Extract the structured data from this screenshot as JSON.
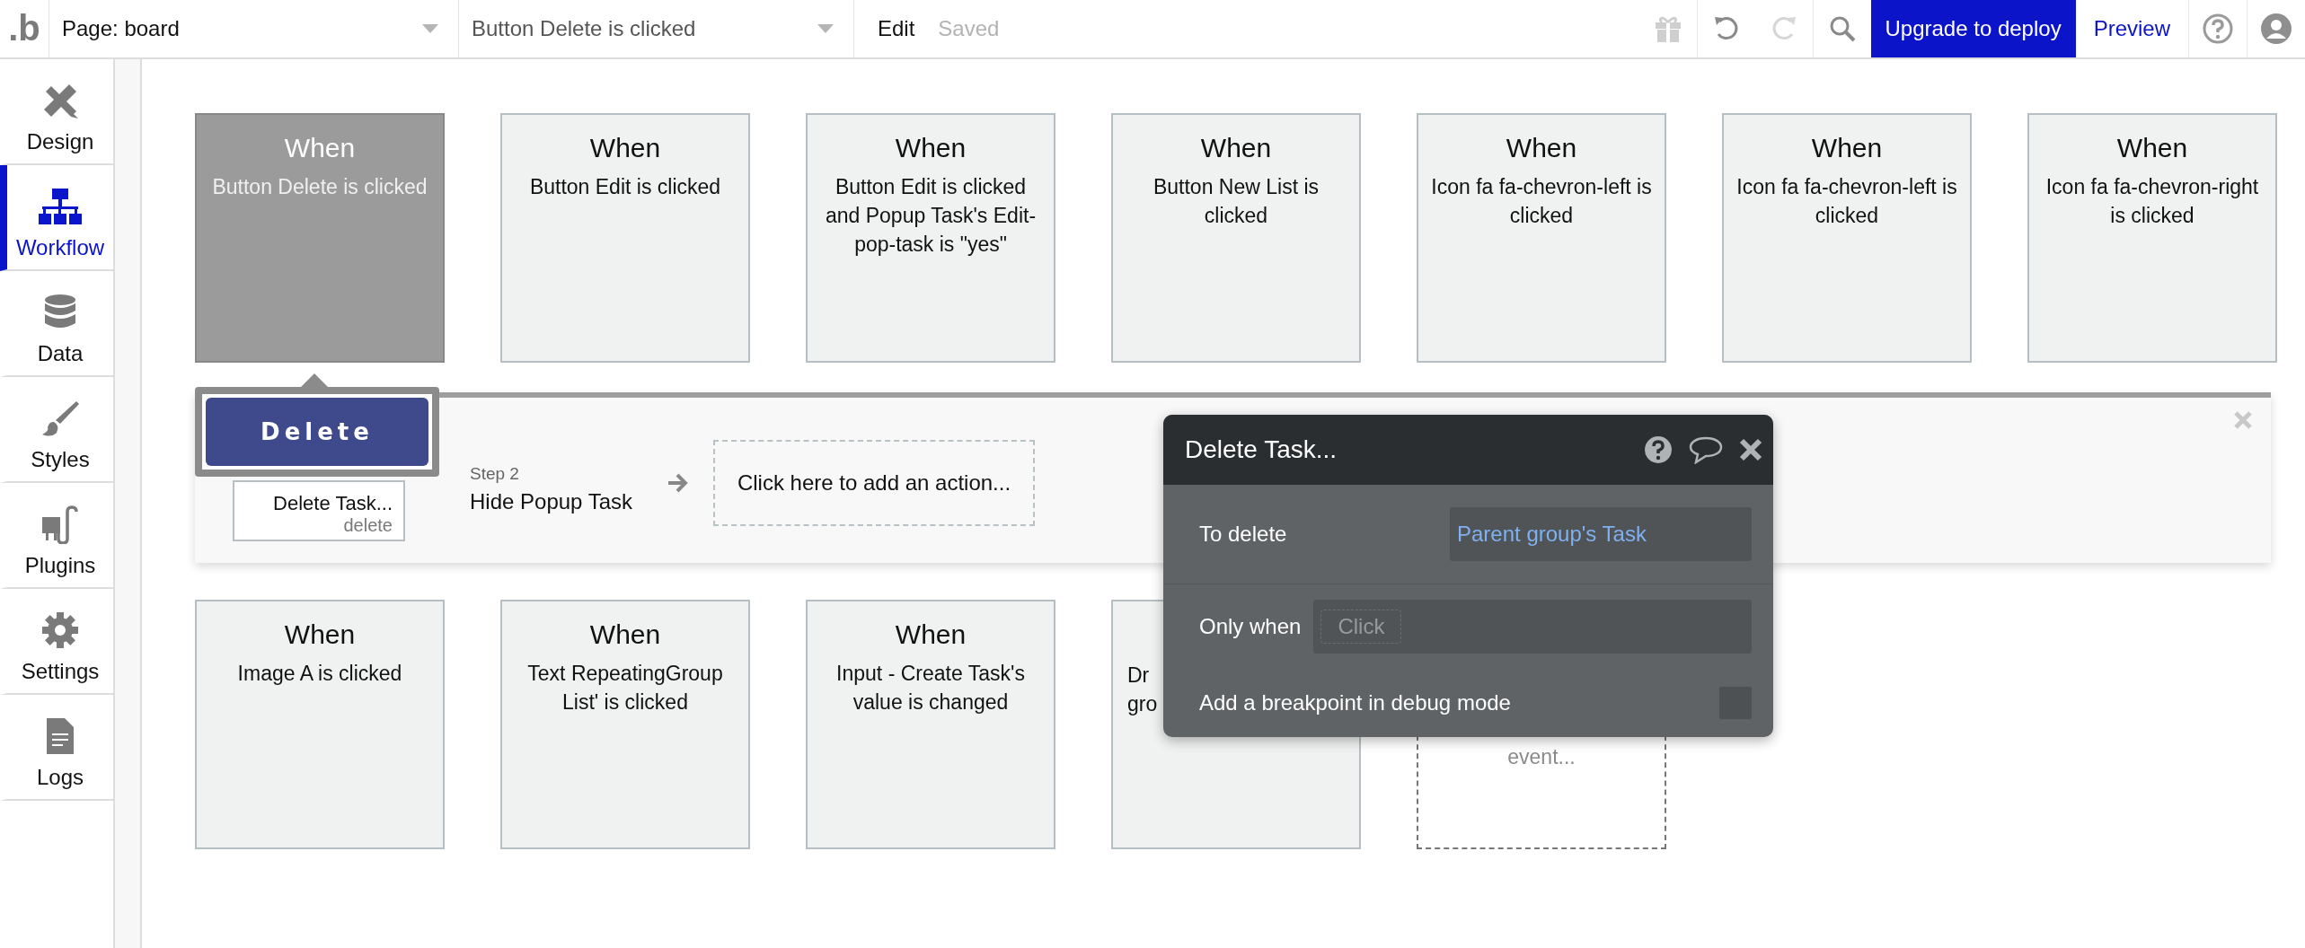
{
  "topbar": {
    "logo": ".b",
    "page_select": "Page: board",
    "event_select": "Button Delete is clicked",
    "edit": "Edit",
    "saved": "Saved",
    "upgrade": "Upgrade to deploy",
    "preview": "Preview"
  },
  "sidebar": {
    "items": [
      {
        "label": "Design",
        "kind": "design",
        "selected": false
      },
      {
        "label": "Workflow",
        "kind": "workflow",
        "selected": true
      },
      {
        "label": "Data",
        "kind": "data",
        "selected": false
      },
      {
        "label": "Styles",
        "kind": "styles",
        "selected": false
      },
      {
        "label": "Plugins",
        "kind": "plugins",
        "selected": false
      },
      {
        "label": "Settings",
        "kind": "settings",
        "selected": false
      },
      {
        "label": "Logs",
        "kind": "logs",
        "selected": false
      }
    ]
  },
  "events_top": [
    {
      "title": "When",
      "text": "Button Delete is clicked",
      "selected": true
    },
    {
      "title": "When",
      "text": "Button Edit is clicked",
      "selected": false
    },
    {
      "title": "When",
      "text": "Button Edit is clicked and Popup Task's Edit-pop-task is \"yes\"",
      "selected": false
    },
    {
      "title": "When",
      "text": "Button New List is clicked",
      "selected": false
    },
    {
      "title": "When",
      "text": "Icon fa fa-chevron-left is clicked",
      "selected": false
    },
    {
      "title": "When",
      "text": "Icon fa fa-chevron-left is clicked",
      "selected": false
    },
    {
      "title": "When",
      "text": "Icon fa fa-chevron-right is clicked",
      "selected": false
    }
  ],
  "workflow": {
    "steps": [
      {
        "kind": "action",
        "title": "Delete Task...",
        "subtitle": "delete"
      },
      {
        "kind": "plain",
        "step": "Step 2",
        "title": "Hide Popup Task"
      },
      {
        "kind": "add",
        "title": "Click here to add an action..."
      }
    ]
  },
  "events_bottom": [
    {
      "kind": "event",
      "title": "When",
      "text": "Image A is clicked",
      "selected": false
    },
    {
      "kind": "event",
      "title": "When",
      "text": "Text RepeatingGroup List' is clicked",
      "selected": false
    },
    {
      "kind": "event",
      "title": "When",
      "text": "Input - Create Task's value is changed",
      "selected": false
    },
    {
      "kind": "covered",
      "lines": [
        "Dr",
        "gro"
      ]
    },
    {
      "kind": "add",
      "text": "event..."
    }
  ],
  "delete_button": {
    "label": "Delete"
  },
  "popup": {
    "title": "Delete Task...",
    "rows": [
      {
        "kind": "value",
        "label": "To delete",
        "value": "Parent group's Task"
      },
      {
        "kind": "condition",
        "label": "Only when",
        "placeholder": "Click"
      },
      {
        "kind": "checkbox",
        "label": "Add a breakpoint in debug mode",
        "checked": false
      }
    ]
  }
}
